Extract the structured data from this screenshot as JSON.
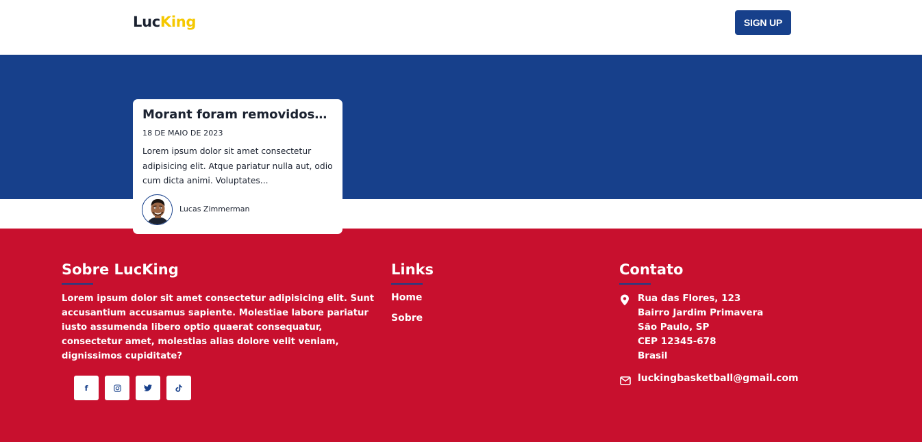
{
  "header": {
    "logo_part1": "Luc",
    "logo_part2": "King",
    "signup_label": "SIGN UP"
  },
  "post_card": {
    "title": "Morant foram removidos do time",
    "date": "18 DE MAIO DE 2023",
    "excerpt": "Lorem ipsum dolor sit amet consectetur adipisicing elit. Atque pariatur nulla aut, odio cum dicta animi. Voluptates...",
    "author": "Lucas Zimmerman"
  },
  "footer": {
    "about": {
      "heading": "Sobre LucKing",
      "text": "Lorem ipsum dolor sit amet consectetur adipisicing elit. Sunt accusantium accusamus sapiente. Molestiae labore pariatur iusto assumenda libero optio quaerat consequatur, consectetur amet, molestias alias dolore velit veniam, dignissimos cupiditate?"
    },
    "social": [
      {
        "icon": "facebook-icon",
        "glyph": "f"
      },
      {
        "icon": "instagram-icon",
        "glyph": "◎"
      },
      {
        "icon": "twitter-icon",
        "glyph": "✦"
      },
      {
        "icon": "tiktok-icon",
        "glyph": "♪"
      }
    ],
    "links": {
      "heading": "Links",
      "items": [
        "Home",
        "Sobre"
      ]
    },
    "contact": {
      "heading": "Contato",
      "address_lines": [
        "Rua das Flores, 123",
        "Bairro Jardim Primavera",
        "São Paulo, SP",
        "CEP 12345-678",
        "Brasil"
      ],
      "email": "luckingbasketball@gmail.com"
    }
  },
  "colors": {
    "primary_blue": "#17408b",
    "footer_red": "#c8102e",
    "logo_yellow": "#f5c800",
    "text_dark": "#1b2230"
  }
}
